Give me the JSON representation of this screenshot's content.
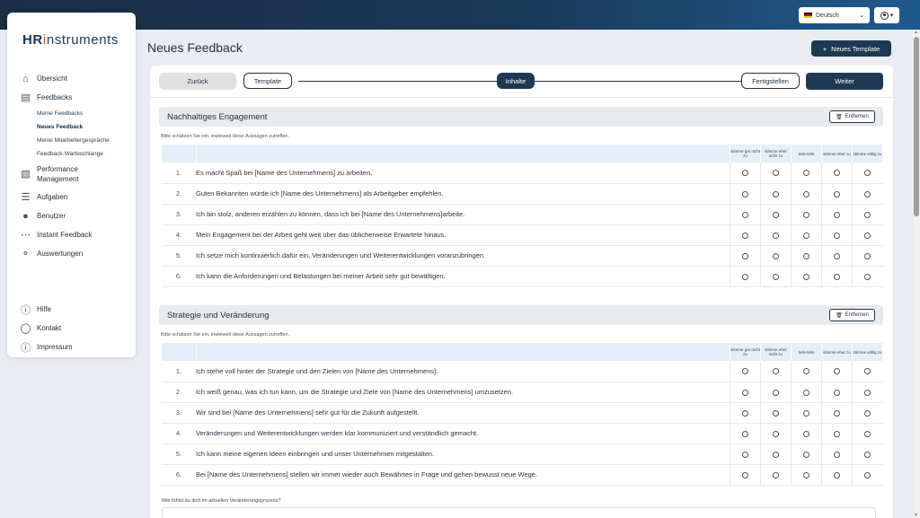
{
  "header": {
    "language": "Deutsch",
    "colors": {
      "topbar_start": "#1a2d44",
      "topbar_end": "#1f5a8e",
      "primary": "#1e3a52"
    }
  },
  "sidebar": {
    "logo": {
      "hr": "HR",
      "i": "i",
      "rest": "nstruments"
    },
    "items": [
      {
        "label": "Übersicht",
        "icon": "home-icon"
      },
      {
        "label": "Feedbacks",
        "icon": "clipboard-icon"
      },
      {
        "label": "Performance Management",
        "icon": "bar-chart-icon"
      },
      {
        "label": "Aufgaben",
        "icon": "tasks-icon"
      },
      {
        "label": "Benutzer",
        "icon": "user-icon"
      },
      {
        "label": "Instant Feedback",
        "icon": "chat-bubble-icon"
      },
      {
        "label": "Auswertungen",
        "icon": "analytics-icon"
      }
    ],
    "feedback_sub": [
      {
        "label": "Meine Feedbacks"
      },
      {
        "label": "Neues Feedback"
      },
      {
        "label": "Meine Mitarbeitergespräche"
      },
      {
        "label": "Feedback-Warteschlange"
      }
    ],
    "bottom": [
      {
        "label": "Hilfe",
        "icon": "question-icon"
      },
      {
        "label": "Kontakt",
        "icon": "speech-icon"
      },
      {
        "label": "Impressum",
        "icon": "info-icon"
      }
    ]
  },
  "page": {
    "title": "Neues Feedback",
    "new_template": "Neues Template",
    "back": "Zurück",
    "steps": [
      "Template",
      "Inhalte",
      "Fertigstellen"
    ],
    "next": "Weiter"
  },
  "scale_labels": [
    "stimme gar nicht zu",
    "stimme eher nicht zu",
    "teils-teils",
    "stimme eher zu",
    "stimme völlig zu"
  ],
  "sections": [
    {
      "title": "Nachhaltiges Engagement",
      "remove": "Entfernen",
      "hint": "Bitte schätzen Sie ein, inwieweit diese Aussagen zutreffen.",
      "questions": [
        {
          "num": "1.",
          "text": "Es macht Spaß bei [Name des Unternehmens] zu arbeiten."
        },
        {
          "num": "2.",
          "text": "Guten Bekannten würde ich [Name des Unternehmens] als Arbeitgeber empfehlen."
        },
        {
          "num": "3.",
          "text": "Ich bin stolz, anderen erzählen zu können, dass ich bei [Name des Unternehmens]arbeite."
        },
        {
          "num": "4.",
          "text": "Mein Engagement bei der Arbeit geht weit über das üblicherweise Erwartete hinaus."
        },
        {
          "num": "5.",
          "text": "Ich setze mich kontinuierlich dafür ein, Veränderungen und Weiterentwicklungen voranzubringen."
        },
        {
          "num": "6.",
          "text": "Ich kann die Anforderungen und Belastungen bei meiner Arbeit sehr gut bewältigen."
        }
      ]
    },
    {
      "title": "Strategie und Veränderung",
      "remove": "Entfernen",
      "hint": "Bitte schätzen Sie ein, inwieweit diese Aussagen zutreffen.",
      "questions": [
        {
          "num": "1.",
          "text": "Ich stehe voll hinter der Strategie und den Zielen von [Name des Unternehmens]."
        },
        {
          "num": "2.",
          "text": "Ich weiß genau, was ich tun kann, um die Strategie und Ziele von [Name des Unternehmens] umzusetzen."
        },
        {
          "num": "3.",
          "text": "Wir sind bei [Name des Unternehmens] sehr gut für die Zukunft aufgestellt."
        },
        {
          "num": "4.",
          "text": "Veränderungen und Weiterentwicklungen werden klar kommuniziert und verständlich gemacht."
        },
        {
          "num": "5.",
          "text": "Ich kann meine eigenen Ideen einbringen und unser Unternehmen mitgestalten."
        },
        {
          "num": "6.",
          "text": "Bei [Name des Unternehmens] stellen wir immer wieder auch Bewährtes in Frage und gehen bewusst neue Wege."
        }
      ]
    }
  ],
  "free_text_label": "Wie fühlst du dich im aktuellen Veränderungsprozess?"
}
